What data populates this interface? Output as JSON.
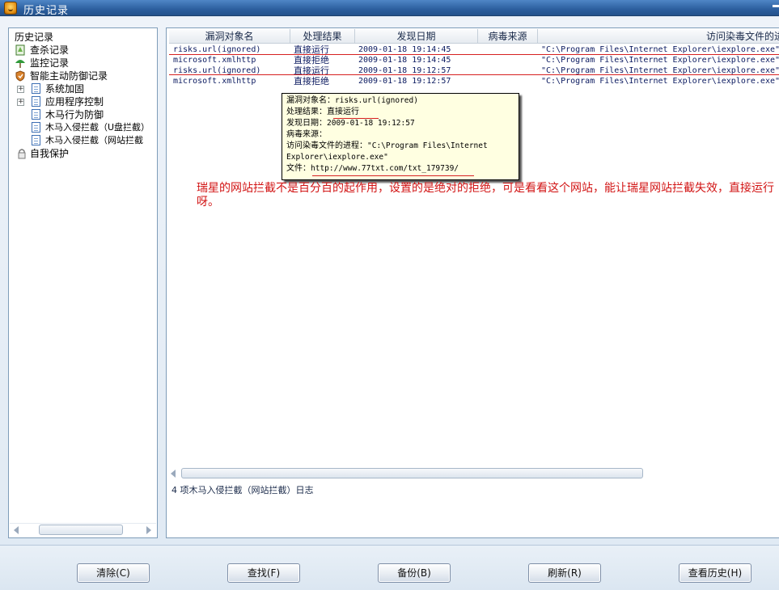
{
  "window": {
    "title": "历史记录"
  },
  "tree": {
    "root": "历史记录",
    "items": [
      {
        "label": "查杀记录",
        "icon": "scan-log-icon"
      },
      {
        "label": "监控记录",
        "icon": "monitor-umbrella-icon"
      },
      {
        "label": "智能主动防御记录",
        "icon": "shield-icon"
      },
      {
        "label": "系统加固",
        "icon": "page-icon"
      },
      {
        "label": "应用程序控制",
        "icon": "page-icon"
      },
      {
        "label": "木马行为防御",
        "icon": "page-icon"
      },
      {
        "label": "木马入侵拦截（U盘拦截）",
        "icon": "page-icon"
      },
      {
        "label": "木马入侵拦截（网站拦截",
        "icon": "page-icon"
      },
      {
        "label": "自我保护",
        "icon": "lock-icon"
      }
    ]
  },
  "table": {
    "columns": [
      "漏洞对象名",
      "处理结果",
      "发现日期",
      "病毒来源",
      "访问染毒文件的进"
    ],
    "rows": [
      {
        "object": "risks.url(ignored)",
        "result": "直接运行",
        "date": "2009-01-18 19:14:45",
        "source": "",
        "process": "\"C:\\Program Files\\Internet Explorer\\iexplore.exe\""
      },
      {
        "object": "microsoft.xmlhttp",
        "result": "直接拒绝",
        "date": "2009-01-18 19:14:45",
        "source": "",
        "process": "\"C:\\Program Files\\Internet Explorer\\iexplore.exe\""
      },
      {
        "object": "risks.url(ignored)",
        "result": "直接运行",
        "date": "2009-01-18 19:12:57",
        "source": "",
        "process": "\"C:\\Program Files\\Internet Explorer\\iexplore.exe\""
      },
      {
        "object": "microsoft.xmlhttp",
        "result": "直接拒绝",
        "date": "2009-01-18 19:12:57",
        "source": "",
        "process": "\"C:\\Program Files\\Internet Explorer\\iexplore.exe\""
      }
    ]
  },
  "tooltip": {
    "object_label": "漏洞对象名：",
    "object_value": "risks.url(ignored)",
    "result_label": "处理结果：",
    "result_value": "直接运行",
    "date_label": "发现日期：",
    "date_value": "2009-01-18 19:12:57",
    "source_label": "病毒来源：",
    "process_label": "访问染毒文件的进程：",
    "process_value_1": "\"C:\\Program Files\\Internet",
    "process_value_2": "Explorer\\iexplore.exe\"",
    "file_label": "文件：",
    "file_value": "http://www.77txt.com/txt_179739/"
  },
  "annotation": "瑞星的网站拦截不是百分百的起作用，设置的是绝对的拒绝，可是看看这个网站，能让瑞星网站拦截失效，直接运行呀。",
  "status": "4 项木马入侵拦截（网站拦截）日志",
  "buttons": [
    {
      "label": "清除(C)"
    },
    {
      "label": "查找(F)"
    },
    {
      "label": "备份(B)"
    },
    {
      "label": "刷新(R)"
    },
    {
      "label": "查看历史(H)"
    }
  ],
  "colors": {
    "titlebar": "#2c5f9e",
    "annotation": "#d21414",
    "tooltip_bg": "#ffffe1",
    "highlight_line": "#d62020"
  }
}
